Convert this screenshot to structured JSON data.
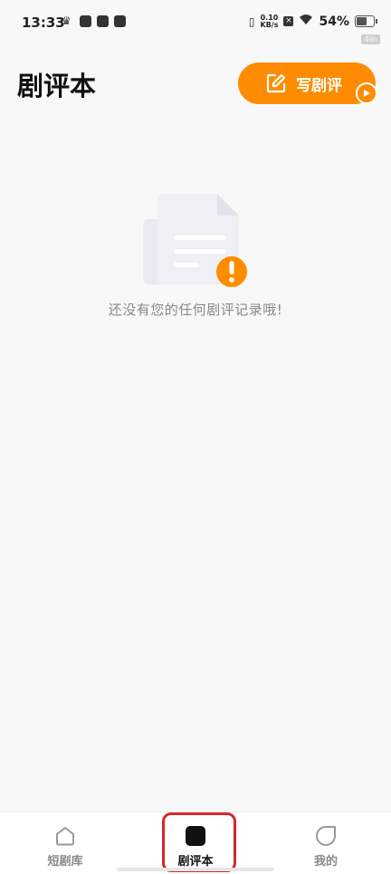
{
  "status_bar": {
    "time": "13:33",
    "net_speed_value": "0.10",
    "net_speed_unit": "KB/s",
    "battery": "54%",
    "tag": "4iin"
  },
  "header": {
    "title": "剧评本",
    "write_button_label": "写剧评"
  },
  "empty_state": {
    "message": "还没有您的任何剧评记录哦!"
  },
  "tab_bar": {
    "tabs": [
      {
        "label": "短剧库",
        "icon": "home-icon",
        "active": false
      },
      {
        "label": "剧评本",
        "icon": "square-icon",
        "active": true
      },
      {
        "label": "我的",
        "icon": "leaf-icon",
        "active": false
      }
    ]
  },
  "colors": {
    "accent": "#ff8c00",
    "highlight": "#d9252a",
    "background": "#f8f8f8"
  }
}
